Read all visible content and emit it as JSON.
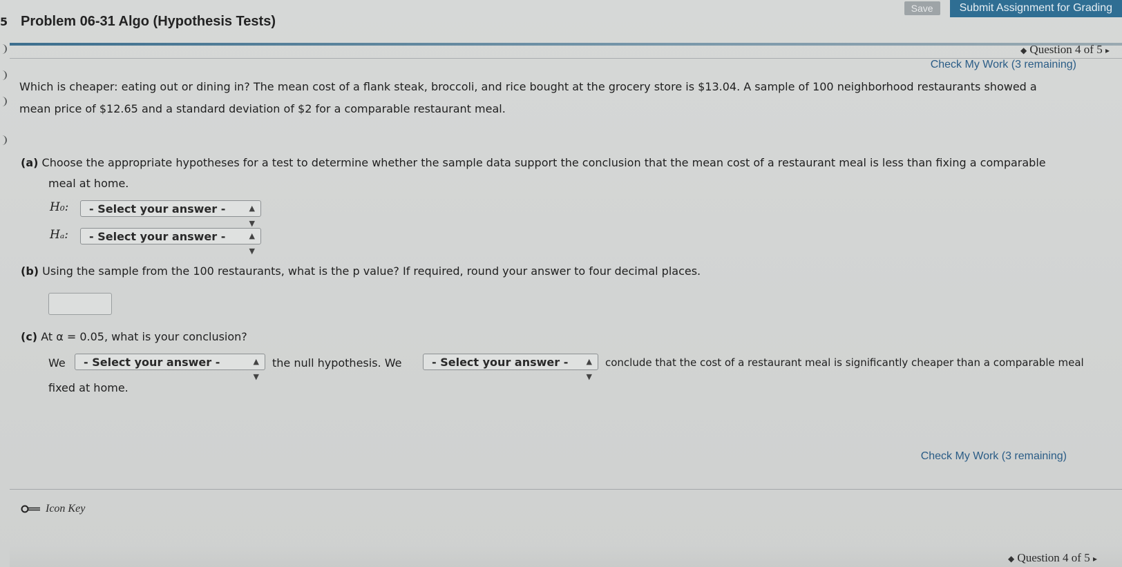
{
  "header": {
    "save_label": "Save",
    "submit_label": "Submit Assignment for Grading",
    "title": "Problem 06-31 Algo (Hypothesis Tests)",
    "rail_number": "5"
  },
  "nav": {
    "question_label_top": "Question 4 of 5",
    "question_label_bottom": "Question 4 of 5",
    "check_top": "Check My Work (3 remaining)",
    "check_bottom": "Check My Work (3 remaining)"
  },
  "problem": {
    "intro_line1": "Which is cheaper: eating out or dining in? The mean cost of a flank steak, broccoli, and rice bought at the grocery store is $13.04. A sample of 100 neighborhood restaurants showed a",
    "intro_line2": "mean price of $12.65 and a standard deviation of $2 for a comparable restaurant meal."
  },
  "part_a": {
    "tag": "(a)",
    "text_line1": "Choose the appropriate hypotheses for a test to determine whether the sample data support the conclusion that the mean cost of a restaurant meal is less than fixing a comparable",
    "text_line2": "meal at home.",
    "h0_label": "H₀:",
    "ha_label": "Hₐ:",
    "h0_select": "- Select your answer -",
    "ha_select": "- Select your answer -"
  },
  "part_b": {
    "tag": "(b)",
    "text": "Using the sample from the 100 restaurants, what is the p value? If required, round your answer to four decimal places.",
    "answer_value": ""
  },
  "part_c": {
    "tag": "(c)",
    "text": "At α = 0.05, what is your conclusion?",
    "we1": "We",
    "select1": "- Select your answer -",
    "mid_text": "the null hypothesis. We",
    "select2": "- Select your answer -",
    "end_text": "conclude that the cost of a restaurant meal is significantly cheaper than a comparable meal",
    "end_text2": "fixed at home."
  },
  "footer": {
    "icon_key_label": "Icon Key"
  }
}
